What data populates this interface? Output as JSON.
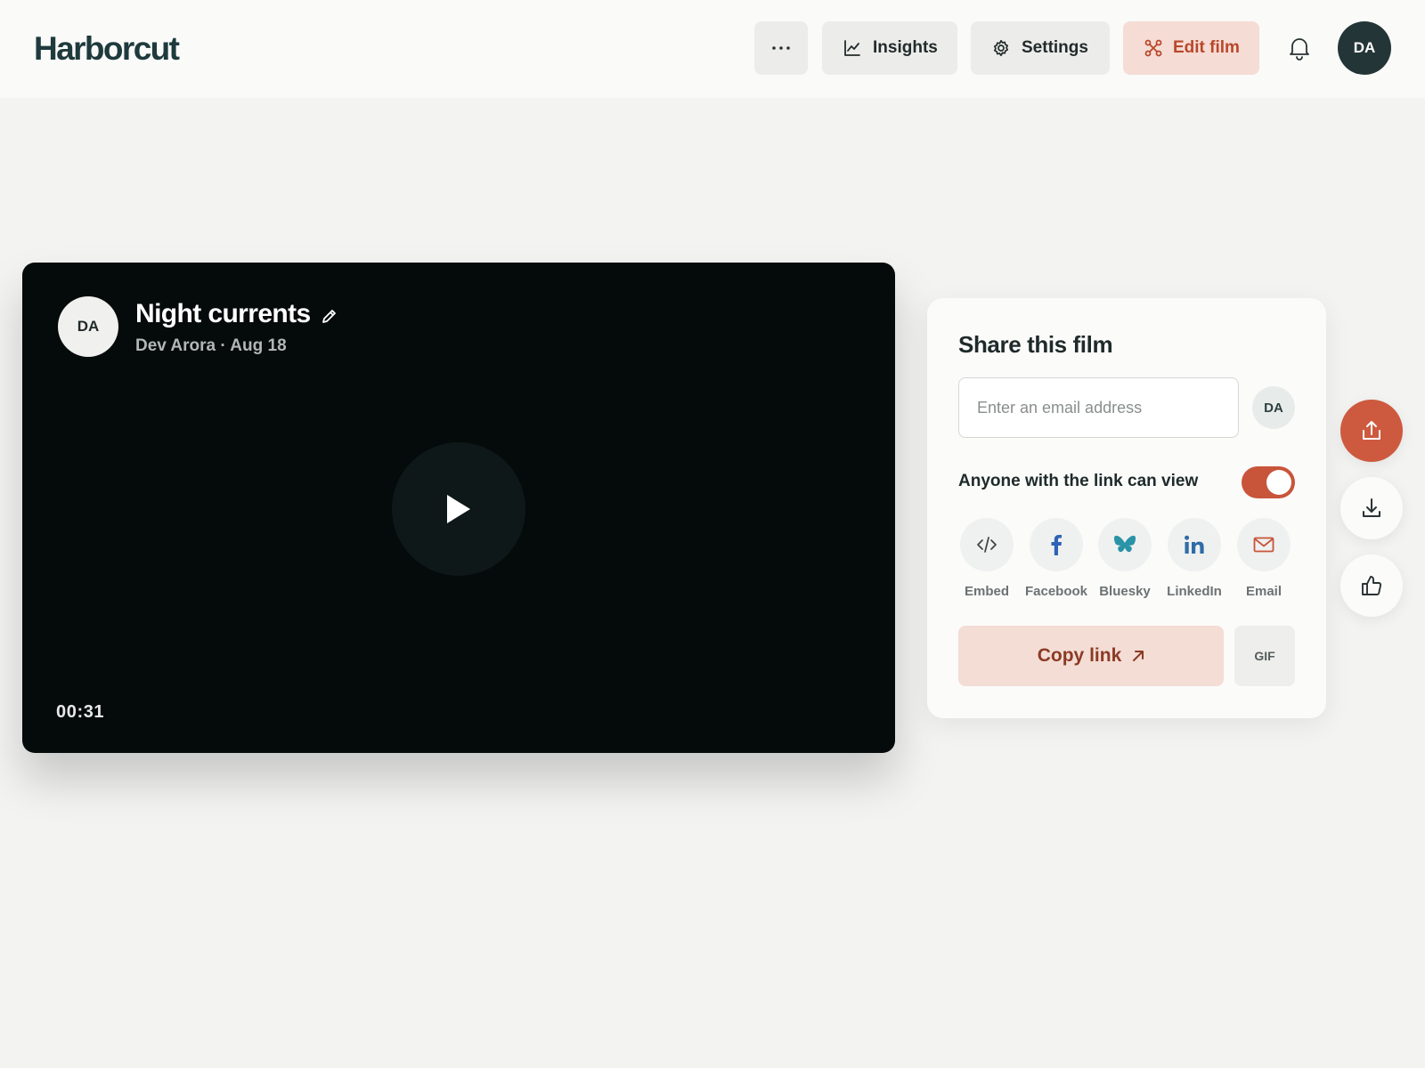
{
  "app": {
    "logo": "Harborcut"
  },
  "header": {
    "more_label": "···",
    "insights_label": "Insights",
    "settings_label": "Settings",
    "edit_label": "Edit film",
    "user_initials": "DA"
  },
  "player": {
    "avatar_initials": "DA",
    "title": "Night currents",
    "meta": "Dev Arora · Aug 18",
    "timestamp": "00:31"
  },
  "share": {
    "title": "Share this film",
    "email_placeholder": "Enter an email address",
    "avatar_initials": "DA",
    "toggle_label": "Anyone with the link can view",
    "toggle_on": true,
    "options": [
      {
        "label": "Embed",
        "icon": "code-icon"
      },
      {
        "label": "Facebook",
        "icon": "facebook-icon"
      },
      {
        "label": "Bluesky",
        "icon": "bluesky-icon"
      },
      {
        "label": "LinkedIn",
        "icon": "linkedin-icon"
      },
      {
        "label": "Email",
        "icon": "mail-icon"
      }
    ],
    "copy_label": "Copy link",
    "gif_label": "GIF"
  },
  "actions": [
    {
      "icon": "upload-icon"
    },
    {
      "icon": "download-icon"
    },
    {
      "icon": "thumbs-up-icon"
    }
  ],
  "colors": {
    "accent": "#cd5a3f",
    "accent_soft": "#f5dcd4",
    "brand_dark": "#1e3a3c",
    "facebook": "#2f63b6",
    "bluesky": "#2a93a8",
    "linkedin": "#2e6ca8"
  }
}
